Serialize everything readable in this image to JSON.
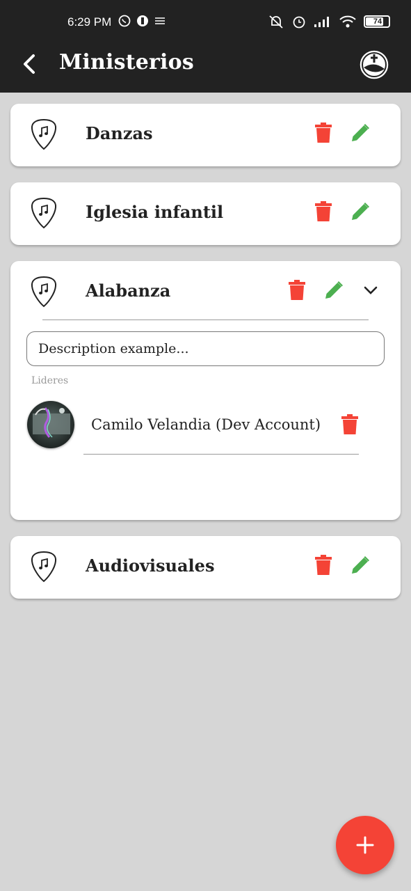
{
  "status_bar": {
    "time": "6:29 PM",
    "battery": "74"
  },
  "header": {
    "title": "Ministerios"
  },
  "ministries": [
    {
      "name": "Danzas"
    },
    {
      "name": "Iglesia infantil"
    },
    {
      "name": "Alabanza",
      "expanded": true,
      "description": "Description example...",
      "leaders_label": "Lideres",
      "leaders": [
        {
          "name": "Camilo Velandia (Dev Account)"
        }
      ]
    },
    {
      "name": "Audiovisuales"
    }
  ],
  "icons": {
    "pick": "guitar-pick-music-icon",
    "delete": "trash-icon",
    "edit": "pencil-icon",
    "expand": "chevron-down-icon",
    "add": "plus-icon"
  },
  "colors": {
    "app_bar": "#222222",
    "background": "#d6d6d6",
    "delete": "#f44336",
    "edit": "#4caf50",
    "fab": "#f44336"
  }
}
